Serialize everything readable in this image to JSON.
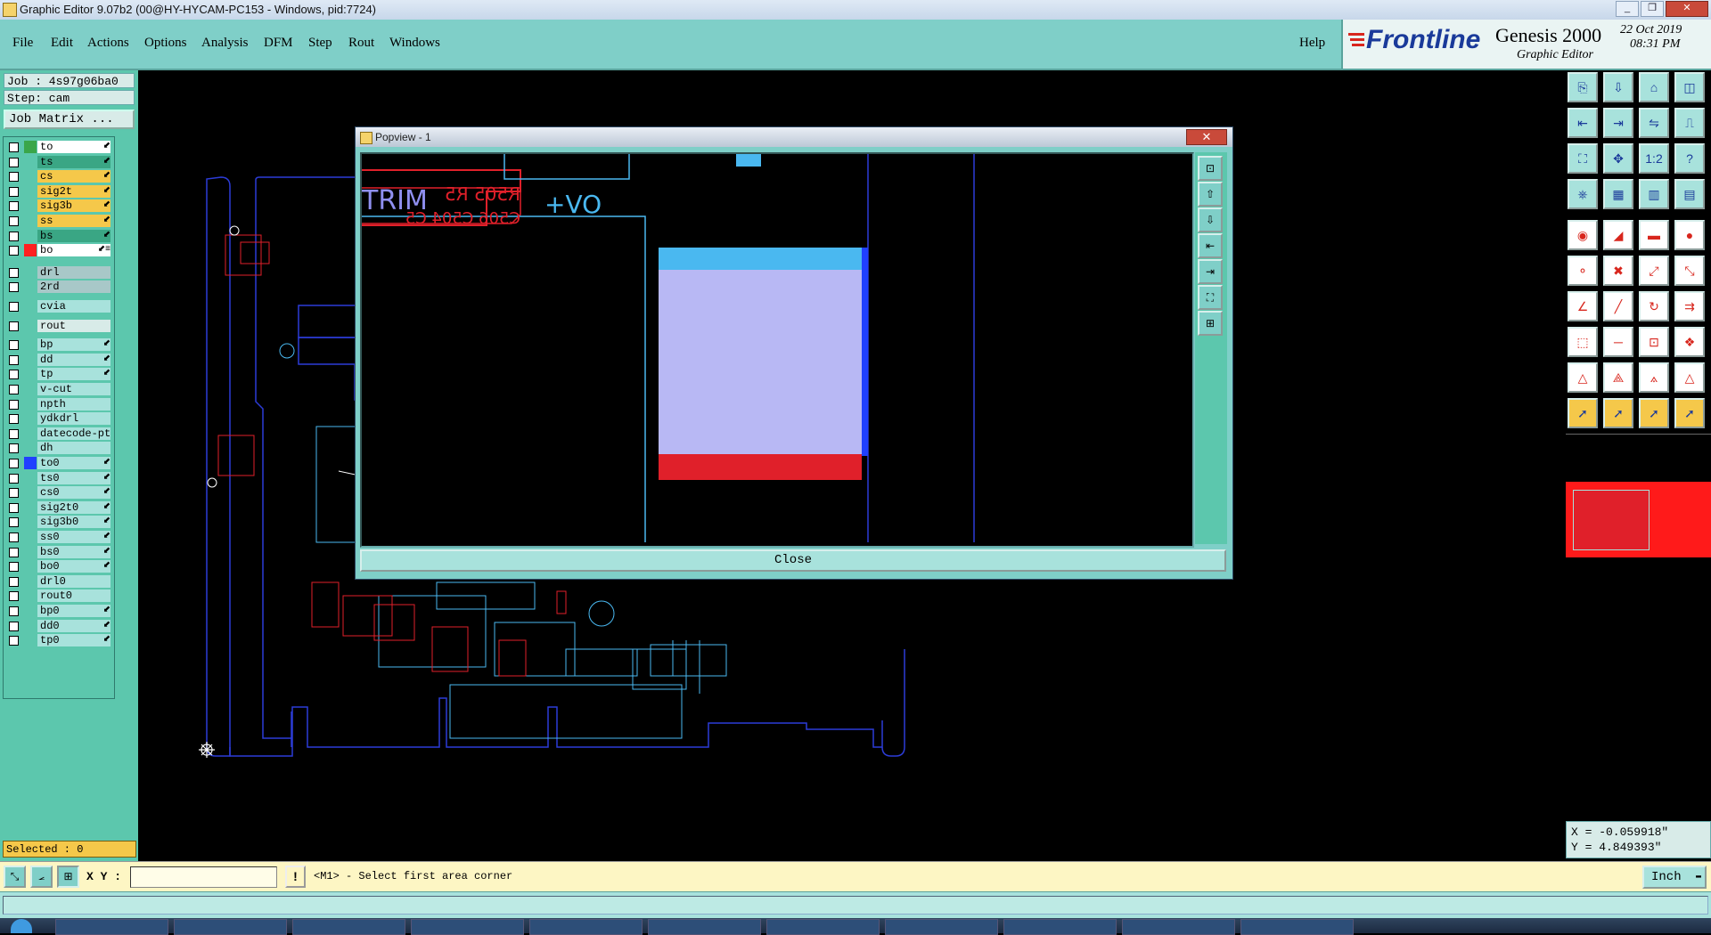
{
  "window": {
    "title": "Graphic Editor 9.07b2 (00@HY-HYCAM-PC153 - Windows, pid:7724)",
    "buttons": [
      "_",
      "❐",
      "✕"
    ]
  },
  "menu": {
    "items": [
      "File",
      "Edit",
      "Actions",
      "Options",
      "Analysis",
      "DFM",
      "Step",
      "Rout",
      "Windows"
    ],
    "help": "Help"
  },
  "brand": {
    "logo": "Frontline",
    "product": "Genesis 2000",
    "subtitle": "Graphic Editor",
    "date": "22 Oct 2019",
    "time": "08:31 PM"
  },
  "job": {
    "job_line": "Job : 4s97g06ba0",
    "step_line": "Step: cam",
    "matrix_button": "Job Matrix ..."
  },
  "layers": [
    {
      "name": "to",
      "swatch": "#3aa64a",
      "color": "#ffffff",
      "mark": "⬋"
    },
    {
      "name": "ts",
      "swatch": "",
      "color": "#3aa684",
      "mark": "⬋"
    },
    {
      "name": "cs",
      "swatch": "",
      "color": "#f5c84a",
      "mark": "⬋"
    },
    {
      "name": "sig2t",
      "swatch": "",
      "color": "#f5c84a",
      "mark": "⬋"
    },
    {
      "name": "sig3b",
      "swatch": "",
      "color": "#f5c84a",
      "mark": "⬋"
    },
    {
      "name": "ss",
      "swatch": "",
      "color": "#f5c84a",
      "mark": "⬋"
    },
    {
      "name": "bs",
      "swatch": "",
      "color": "#3aa684",
      "mark": "⬋"
    },
    {
      "name": "bo",
      "swatch": "#ff2020",
      "color": "#ffffff",
      "mark": "⬋≡"
    },
    {
      "name": "drl",
      "swatch": "",
      "color": "#a8c8c8",
      "mark": ""
    },
    {
      "name": "2rd",
      "swatch": "",
      "color": "#a8c8c8",
      "mark": ""
    },
    {
      "name": "cvia",
      "swatch": "",
      "color": "#a8e2dc",
      "mark": ""
    },
    {
      "name": "rout",
      "swatch": "",
      "color": "#d8ebe8",
      "mark": ""
    },
    {
      "name": "bp",
      "swatch": "",
      "color": "#a8e2dc",
      "mark": "⬋"
    },
    {
      "name": "dd",
      "swatch": "",
      "color": "#a8e2dc",
      "mark": "⬋"
    },
    {
      "name": "tp",
      "swatch": "",
      "color": "#a8e2dc",
      "mark": "⬋"
    },
    {
      "name": "v-cut",
      "swatch": "",
      "color": "#a8e2dc",
      "mark": ""
    },
    {
      "name": "npth",
      "swatch": "",
      "color": "#a8e2dc",
      "mark": ""
    },
    {
      "name": "ydkdrl",
      "swatch": "",
      "color": "#a8e2dc",
      "mark": ""
    },
    {
      "name": "datecode-ptc",
      "swatch": "",
      "color": "#a8e2dc",
      "mark": ""
    },
    {
      "name": "dh",
      "swatch": "",
      "color": "#a8e2dc",
      "mark": ""
    },
    {
      "name": "to0",
      "swatch": "#2040ff",
      "color": "#a8e2dc",
      "mark": "⬋"
    },
    {
      "name": "ts0",
      "swatch": "",
      "color": "#a8e2dc",
      "mark": "⬋"
    },
    {
      "name": "cs0",
      "swatch": "",
      "color": "#a8e2dc",
      "mark": "⬋"
    },
    {
      "name": "sig2t0",
      "swatch": "",
      "color": "#a8e2dc",
      "mark": "⬋"
    },
    {
      "name": "sig3b0",
      "swatch": "",
      "color": "#a8e2dc",
      "mark": "⬋"
    },
    {
      "name": "ss0",
      "swatch": "",
      "color": "#a8e2dc",
      "mark": "⬋"
    },
    {
      "name": "bs0",
      "swatch": "",
      "color": "#a8e2dc",
      "mark": "⬋"
    },
    {
      "name": "bo0",
      "swatch": "",
      "color": "#a8e2dc",
      "mark": "⬋"
    },
    {
      "name": "drl0",
      "swatch": "",
      "color": "#a8e2dc",
      "mark": ""
    },
    {
      "name": "rout0",
      "swatch": "",
      "color": "#a8e2dc",
      "mark": ""
    },
    {
      "name": "bp0",
      "swatch": "",
      "color": "#a8e2dc",
      "mark": "⬋"
    },
    {
      "name": "dd0",
      "swatch": "",
      "color": "#a8e2dc",
      "mark": "⬋"
    },
    {
      "name": "tp0",
      "swatch": "",
      "color": "#a8e2dc",
      "mark": "⬋"
    }
  ],
  "selected": "Selected : 0",
  "popview": {
    "title": "Popview - 1",
    "close_x": "✕",
    "close_button": "Close",
    "texts": [
      "TRIM",
      "R505 R5",
      "C506 C504 C5",
      "+VO"
    ],
    "side_icons": [
      "zoom-window-icon",
      "zoom-in-icon",
      "zoom-out-icon",
      "pan-left-icon",
      "pan-right-icon",
      "zoom-fit-icon",
      "zoom-extents-icon"
    ]
  },
  "toolbar_icons": [
    "open-step-icon",
    "save-icon",
    "home-icon",
    "layout-icon",
    "pan-left-icon",
    "pan-right-icon",
    "mirror-icon",
    "step-icon",
    "fit-icon",
    "center-icon",
    "ratio-icon",
    "help-icon",
    "snap-icon",
    "grid-icon",
    "layers-icon",
    "colors-icon",
    "camera-icon",
    "draw-icon",
    "ruler-icon",
    "circle-icon",
    "node-icon",
    "cross-icon",
    "connect-icon",
    "split-icon",
    "angle-icon",
    "line-icon",
    "arc-icon",
    "align-icon",
    "move-icon",
    "trim-icon",
    "measure-icon",
    "pad-icon",
    "tri-a-icon",
    "tri-b-icon",
    "tri-c-icon",
    "tri-d-icon",
    "select-icon",
    "select-plus-icon",
    "select-minus-icon",
    "select-net-icon"
  ],
  "toolbar_labels": [
    "",
    "",
    "",
    "",
    "",
    "",
    "",
    "",
    "",
    "",
    "1:2",
    "?",
    "",
    "",
    "",
    "",
    "",
    "",
    "",
    "",
    "",
    "",
    "",
    "",
    "",
    "",
    "",
    "",
    "",
    "",
    "",
    "",
    "",
    "",
    "",
    "",
    "",
    "",
    "",
    ""
  ],
  "coords": {
    "x": "X = -0.059918\"",
    "y": "Y = 4.849393\""
  },
  "bottom": {
    "xy_label": "X Y :",
    "xy_value": "",
    "prompt": "<M1> - Select first area corner",
    "units": "Inch"
  },
  "colors": {
    "board_outline": "#2c3cd8",
    "copper_red": "#e0202a",
    "signal_cyan": "#4ab8f0",
    "pad_fill": "#b8b8f4"
  }
}
